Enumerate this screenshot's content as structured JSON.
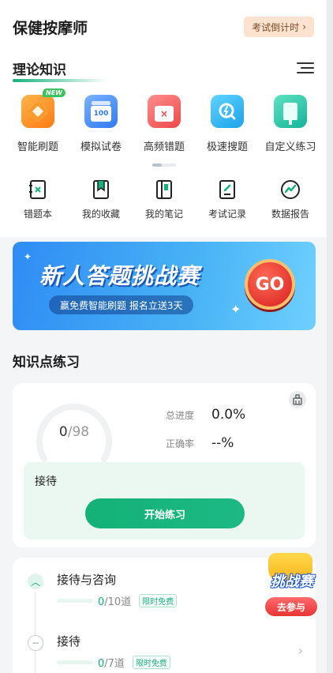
{
  "header": {
    "title": "保健按摩师",
    "countdown_label": "考试倒计时",
    "countdown_chevron": "›"
  },
  "section": {
    "title": "理论知识",
    "menu_icon": "list-menu-icon"
  },
  "features": [
    {
      "label": "智能刷题",
      "icon": "smart-practice-icon",
      "badge": "NEW"
    },
    {
      "label": "模拟试卷",
      "icon": "mock-exam-icon",
      "icon_text": "100"
    },
    {
      "label": "高频错题",
      "icon": "frequent-mistakes-icon",
      "icon_text": "×"
    },
    {
      "label": "极速搜题",
      "icon": "quick-search-icon"
    },
    {
      "label": "自定义练习",
      "icon": "custom-practice-icon"
    }
  ],
  "tools": [
    {
      "label": "错题本",
      "icon": "mistake-book-icon"
    },
    {
      "label": "我的收藏",
      "icon": "bookmark-icon"
    },
    {
      "label": "我的笔记",
      "icon": "notes-icon"
    },
    {
      "label": "考试记录",
      "icon": "exam-record-icon"
    },
    {
      "label": "数据报告",
      "icon": "data-report-icon"
    }
  ],
  "banner": {
    "title": "新人答题挑战赛",
    "subtitle": "赢免费智能刷题 报名立送3天",
    "go": "GO"
  },
  "knowledge": {
    "title": "知识点练习",
    "done": "0",
    "slash": "/",
    "total": "98",
    "progress_fraction": 0.0,
    "progress_label": "总进度",
    "progress_value": "0.0%",
    "accuracy_label": "正确率",
    "accuracy_value": "--%",
    "current_point": "接待",
    "start_button": "开始练习"
  },
  "chapters": [
    {
      "name": "接待与咨询",
      "done": "0",
      "total": "/10道",
      "free": "限时免费",
      "state": "expanded"
    },
    {
      "name": "接待",
      "done": "0",
      "total": "/7道",
      "free": "限时免费",
      "state": "collapsed"
    }
  ],
  "challenge": {
    "label": "挑战赛",
    "button": "去参与"
  },
  "colors": {
    "accent": "#13b278",
    "countdown_bg": "#fde3cf",
    "banner_blue": "#2f8cf4",
    "go_red": "#d81e1e"
  }
}
